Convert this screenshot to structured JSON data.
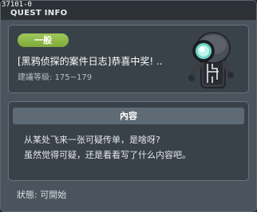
{
  "window": {
    "quest_id": "37101-0",
    "title": "QUEST INFO"
  },
  "summary": {
    "badge": "一般",
    "quest_name": "[黑鸦侦探的案件日志]恭喜中奖! ..",
    "level_label": "建議等級: 175~179",
    "npc_icon": "robot-npc-icon"
  },
  "content": {
    "header": "內容",
    "lines": [
      "从某处飞来一张可疑传单，是啥呀?",
      "虽然觉得可疑，还是看看写了什么内容吧。"
    ]
  },
  "status": "狀態: 可開始",
  "colors": {
    "badge_green": "#8fba4a",
    "panel_bg": "#394149",
    "window_bg": "#4b545d"
  }
}
